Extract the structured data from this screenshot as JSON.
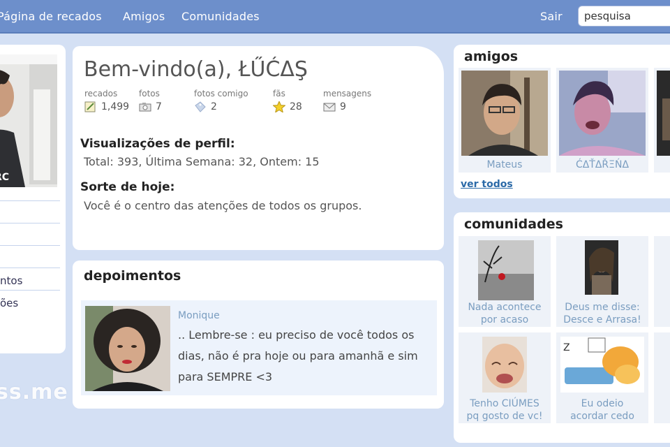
{
  "nav": {
    "home_label": "Página de recados",
    "friends_label": "Amigos",
    "communities_label": "Comunidades",
    "logout_label": "Sair",
    "search_value": "pesquisa"
  },
  "profile": {
    "welcome": "Bem-vindo(a), ŁŰĆΔŞ",
    "stats": [
      {
        "label": "recados",
        "value": "1,499",
        "icon": "notepad-icon"
      },
      {
        "label": "fotos",
        "value": "7",
        "icon": "camera-icon"
      },
      {
        "label": "fotos comigo",
        "value": "2",
        "icon": "photo-tag-icon"
      },
      {
        "label": "fãs",
        "value": "28",
        "icon": "star-icon"
      },
      {
        "label": "mensagens",
        "value": "9",
        "icon": "envelope-icon"
      }
    ],
    "views_title": "Visualizações de perfil:",
    "views_text": "Total: 393, Última Semana: 32, Ontem: 15",
    "luck_title": "Sorte de hoje:",
    "luck_text": "Você é o centro das atenções de todos os grupos."
  },
  "left_menu": {
    "items": [
      "",
      "",
      "",
      "ntos",
      "ões"
    ],
    "watermark": "ss.me"
  },
  "testimonials": {
    "title": "depoimentos",
    "author": "Monique",
    "text": ".. Lembre-se : eu preciso de você todos os dias, não é pra hoje ou para amanhã e sim para SEMPRE <3"
  },
  "friends": {
    "title": "amigos",
    "items": [
      {
        "name": "Mateus"
      },
      {
        "name": "ĆΔŤΔŘΞŃΔ"
      }
    ],
    "see_all": "ver todos"
  },
  "communities": {
    "title": "comunidades",
    "items": [
      {
        "line1": "Nada acontece",
        "line2": "por acaso"
      },
      {
        "line1": "Deus me disse:",
        "line2": "Desce e Arrasa!"
      },
      {
        "line1": "Tenho CIÚMES",
        "line2": "pq gosto de vc!"
      },
      {
        "line1": "Eu odeio",
        "line2": "acordar cedo"
      }
    ]
  }
}
